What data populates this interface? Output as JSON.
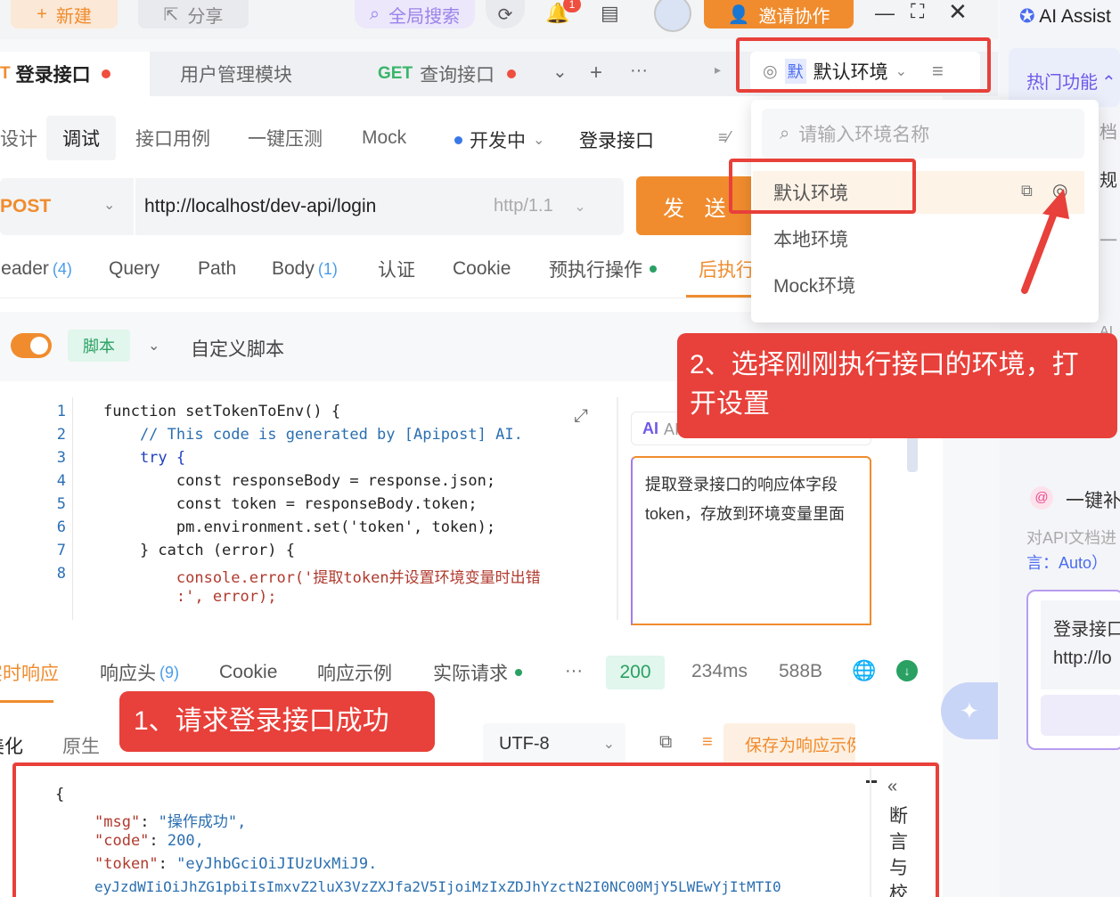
{
  "toolbar": {
    "new_label": "新建",
    "share_label": "分享",
    "search_label": "全局搜索",
    "invite_label": "邀请协作",
    "notification_badge": "1"
  },
  "tabs": [
    {
      "method": "POST",
      "label": "登录接口"
    },
    {
      "label": "用户管理模块"
    },
    {
      "method": "GET",
      "label": "查询接口"
    }
  ],
  "env": {
    "mo": "默",
    "current": "默认环境"
  },
  "subtabs": [
    "设计",
    "调试",
    "接口用例",
    "一键压测",
    "Mock"
  ],
  "status_select": "开发中",
  "api_name": "登录接口",
  "request": {
    "method": "POST",
    "url": "http://localhost/dev-api/login",
    "protocol": "http/1.1",
    "send_label": "发 送"
  },
  "request_tabs": [
    {
      "label": "Header",
      "count": "(4)"
    },
    {
      "label": "Query"
    },
    {
      "label": "Path"
    },
    {
      "label": "Body",
      "count": "(1)"
    },
    {
      "label": "认证"
    },
    {
      "label": "Cookie"
    },
    {
      "label": "预执行操作"
    },
    {
      "label": "后执行操作"
    }
  ],
  "script": {
    "tag": "脚本",
    "title": "自定义脚本"
  },
  "code_lines": [
    "function setTokenToEnv() {",
    "    // This code is generated by [Apipost] AI.",
    "    try {",
    "        const responseBody = response.json;",
    "        const token = responseBody.token;",
    "        pm.environment.set('token', token);",
    "    } catch (error) {",
    "        console.error('提取token并设置环境变量时出错",
    "        :', error);"
  ],
  "ai_panel": {
    "head": "AI生成",
    "prompt": "提取登录接口的响应体字段token，存放到环境变量里面"
  },
  "response": {
    "tabs": [
      {
        "label": "实时响应"
      },
      {
        "label": "响应头",
        "count": "(9)"
      },
      {
        "label": "Cookie"
      },
      {
        "label": "响应示例"
      },
      {
        "label": "实际请求"
      }
    ],
    "status": "200",
    "time": "234ms",
    "size": "588B",
    "view_tabs": [
      "美化",
      "原生"
    ],
    "encoding": "UTF-8",
    "save_label": "保存为响应示例",
    "json_lines": [
      {
        "key": "",
        "value": "{"
      },
      {
        "key": "\"msg\"",
        "value": "\"操作成功\","
      },
      {
        "key": "\"code\"",
        "value": "200,"
      },
      {
        "key": "\"token\"",
        "value": "\"eyJhbGciOiJIUzUxMiJ9."
      },
      {
        "key": "",
        "value": "eyJzdWIiOiJhZG1pbiIsImxvZ2luX3VzZXJfa2V5IjoiMzIxZDJhYzctN2I0NC00MjY5LWEwYjItMTI0"
      }
    ],
    "side_label": "断言与校"
  },
  "dropdown": {
    "placeholder": "请输入环境名称",
    "items": [
      "默认环境",
      "本地环境",
      "Mock环境"
    ]
  },
  "right_sidebar": {
    "title": "AI Assist",
    "hot": "热门功能",
    "fragments": [
      "档",
      "规",
      "一",
      "AI"
    ],
    "oneclick": "一键补",
    "desc": "对API文档进",
    "lang": "言：Auto）",
    "card_title": "登录接口",
    "card_url": "http://lo"
  },
  "annotations": {
    "step1": "1、请求登录接口成功",
    "step2": "2、选择刚刚执行接口的环境，打开设置"
  },
  "colors": {
    "accent": "#f08c2e",
    "annotation_red": "#e8403a",
    "success_green": "#2aa163"
  }
}
